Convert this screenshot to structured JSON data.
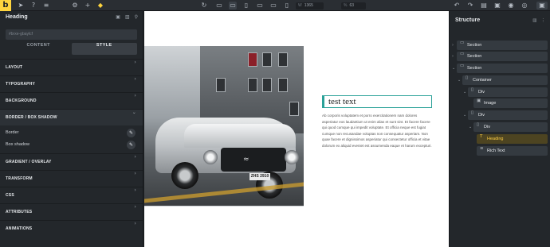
{
  "toolbar": {
    "logo": "b",
    "left_icons": [
      "cursor-icon",
      "help-icon",
      "layers-icon",
      "settings-icon",
      "add-icon",
      "template-icon"
    ],
    "devices": [
      "desktop-icon",
      "laptop-icon",
      "tablet-landscape-icon",
      "tablet-icon",
      "mobile-landscape-icon",
      "mobile-icon"
    ],
    "width_unit": "W",
    "width_value": "1365",
    "zoom_unit": "%",
    "zoom_value": "63",
    "right_icons": [
      "undo-icon",
      "redo-icon",
      "page-icon",
      "save-icon",
      "wordpress-icon",
      "preview-icon",
      "publish-icon"
    ]
  },
  "left_panel": {
    "title": "Heading",
    "search_placeholder": "#brxe-gbaylcf",
    "tabs": [
      {
        "label": "CONTENT",
        "active": false
      },
      {
        "label": "STYLE",
        "active": true
      }
    ],
    "sections_top": [
      "LAYOUT",
      "TYPOGRAPHY",
      "BACKGROUND"
    ],
    "open_section": "BORDER / BOX SHADOW",
    "open_rows": [
      "Border",
      "Box shadow"
    ],
    "sections_bottom": [
      "GRADIENT / OVERLAY",
      "TRANSFORM",
      "CSS",
      "ATTRIBUTES",
      "ANIMATIONS"
    ]
  },
  "canvas": {
    "heading": "test text",
    "paragraph": "Ab corporis voluptatem et porro exercitationem nam dolores asperiatur eos laudantium ut enim alias et sunt sint. Et facere facere qui quod cumque qui impedit voluptate. Et officia neque est fugiat cumque non recusandae voluptas non consequatur asperiam. Non quae facere et dignissimos asperiatur qui consectetur officia et vitae dolorum ex aliquid eveniet est assumenda eaque et harum excepturi.",
    "plate": "ZHS 2910"
  },
  "right_panel": {
    "title": "Structure",
    "nodes": [
      {
        "label": "Section",
        "icon": "section-icon"
      },
      {
        "label": "Section",
        "icon": "section-icon"
      },
      {
        "label": "Section",
        "icon": "section-icon"
      },
      {
        "label": "Container",
        "icon": "container-icon"
      },
      {
        "label": "Div",
        "icon": "div-icon"
      },
      {
        "label": "Image",
        "icon": "image-icon"
      },
      {
        "label": "Div",
        "icon": "div-icon"
      },
      {
        "label": "Div",
        "icon": "div-icon"
      },
      {
        "label": "Heading",
        "icon": "heading-icon",
        "selected": true
      },
      {
        "label": "Rich Text",
        "icon": "richtext-icon"
      }
    ]
  },
  "colors": {
    "accent": "#ffd53e",
    "selected_text": "#ffcf44",
    "panel_bg": "#23272b",
    "heading_outline": "#2aa198"
  }
}
